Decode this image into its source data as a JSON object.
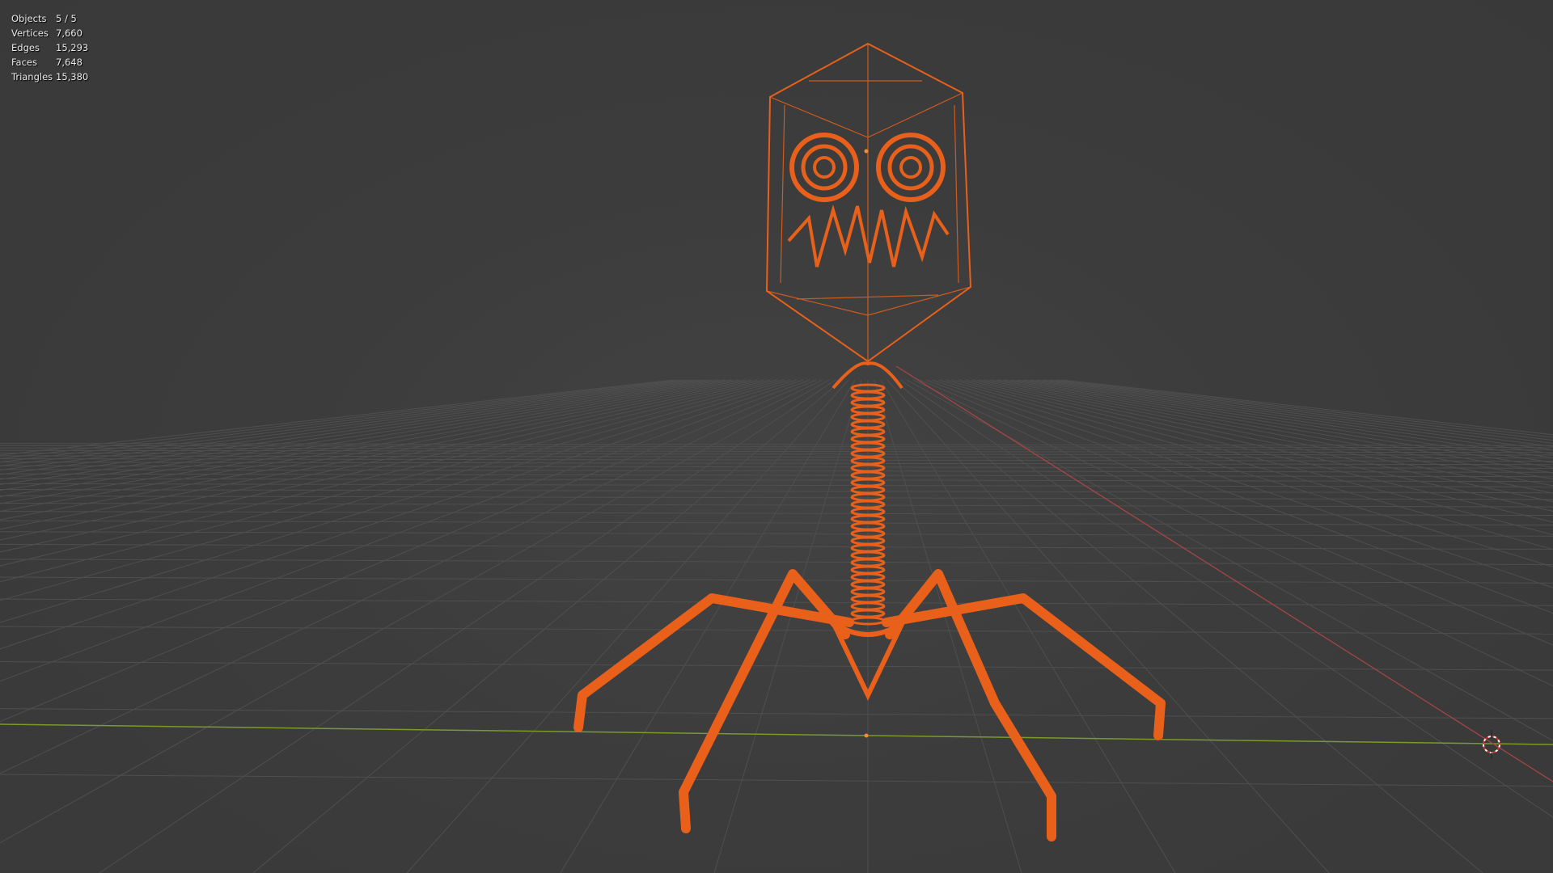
{
  "stats": {
    "rows": [
      {
        "label": "Objects",
        "value": "5 / 5"
      },
      {
        "label": "Vertices",
        "value": "7,660"
      },
      {
        "label": "Edges",
        "value": "15,293"
      },
      {
        "label": "Faces",
        "value": "7,648"
      },
      {
        "label": "Triangles",
        "value": "15,380"
      }
    ]
  },
  "colors": {
    "wire": "#e8601a",
    "x_axis": "#7a9a2a",
    "y_axis": "#a64545",
    "grid": "#505050"
  }
}
